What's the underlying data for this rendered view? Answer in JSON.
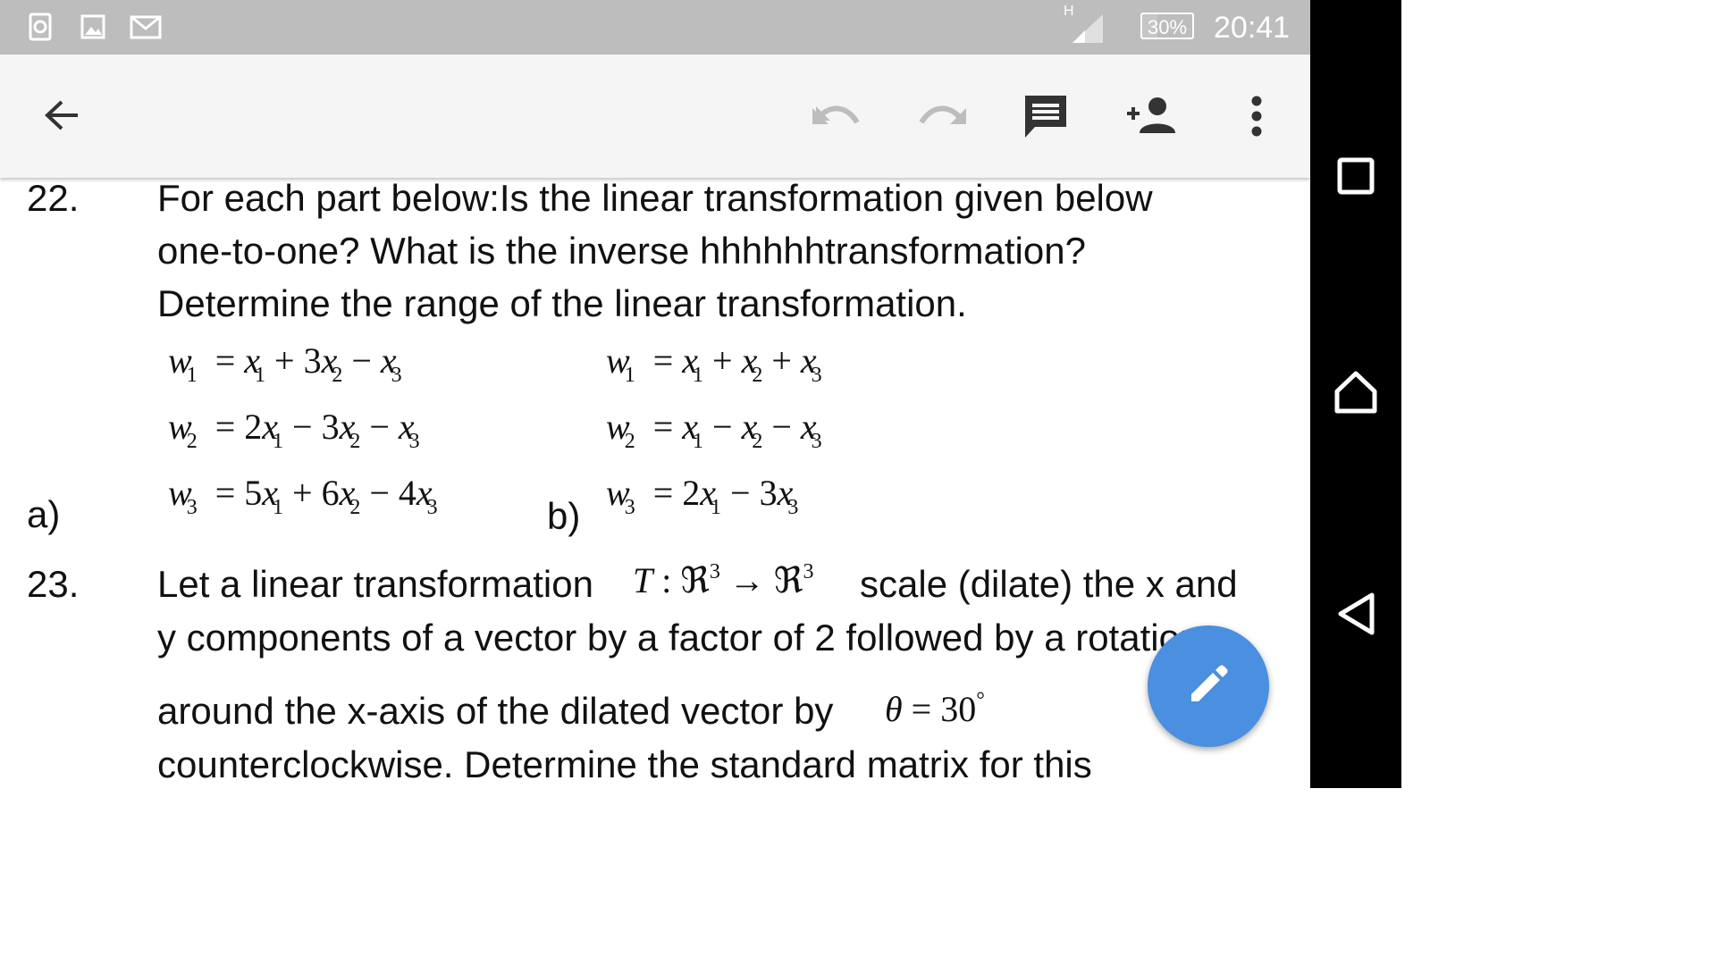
{
  "status_bar": {
    "time": "20:41",
    "battery": "30%",
    "battery_level": 0.3,
    "signal_label": "H",
    "icons": [
      "screenshot-app-icon",
      "gallery-icon",
      "gmail-icon"
    ]
  },
  "toolbar": {
    "back_icon": "arrow-back-icon",
    "actions": [
      "undo-icon",
      "redo-icon",
      "comment-icon",
      "add-person-icon",
      "more-vert-icon"
    ]
  },
  "document": {
    "q22": {
      "number": "22.",
      "line1": "For each part below:Is the linear transformation given below",
      "line2": "one-to-one? What is the inverse hhhhhhtransformation?",
      "line3": "Determine the range of the linear transformation.",
      "part_a_label": "a)",
      "part_b_label": "b)",
      "part_a": [
        {
          "lhs_var": "w",
          "lhs_sub": "1",
          "rhs": [
            "x",
            "1",
            " + 3",
            "x",
            "2",
            " − ",
            "x",
            "3"
          ]
        },
        {
          "lhs_var": "w",
          "lhs_sub": "2",
          "rhs": [
            "2",
            "x",
            "1",
            " − 3",
            "x",
            "2",
            " − ",
            "x",
            "3"
          ]
        },
        {
          "lhs_var": "w",
          "lhs_sub": "3",
          "rhs": [
            "5",
            "x",
            "1",
            " + 6",
            "x",
            "2",
            " − 4",
            "x",
            "3"
          ]
        }
      ],
      "part_b": [
        {
          "lhs_var": "w",
          "lhs_sub": "1",
          "rhs": [
            "x",
            "1",
            " + ",
            "x",
            "2",
            " + ",
            "x",
            "3"
          ]
        },
        {
          "lhs_var": "w",
          "lhs_sub": "2",
          "rhs": [
            "x",
            "1",
            " − ",
            "x",
            "2",
            " − ",
            "x",
            "3"
          ]
        },
        {
          "lhs_var": "w",
          "lhs_sub": "3",
          "rhs": [
            "2",
            "x",
            "1",
            " − 3",
            "x",
            "3"
          ]
        }
      ]
    },
    "q23": {
      "number": "23.",
      "line1_before": "Let a linear transformation",
      "mapping": "T : ℜ³ → ℜ³",
      "line1_after": "scale (dilate) the x and",
      "line2": "y components of a vector by a factor of 2 followed by a rotation",
      "line3_before": "around the x-axis of the dilated vector by",
      "angle": "θ = 30°",
      "line4": "counterclockwise. Determine the standard matrix for this"
    }
  },
  "fab": {
    "icon": "edit-pencil-icon"
  },
  "nav_bar": {
    "buttons": [
      "recents-icon",
      "home-icon",
      "back-icon"
    ]
  },
  "colors": {
    "status_bar": "#bdbdbd",
    "toolbar": "#f5f5f5",
    "fab": "#4a8fe0",
    "nav_bar": "#000000",
    "icon_dark": "#333333",
    "icon_disabled": "#bdbdbd"
  }
}
